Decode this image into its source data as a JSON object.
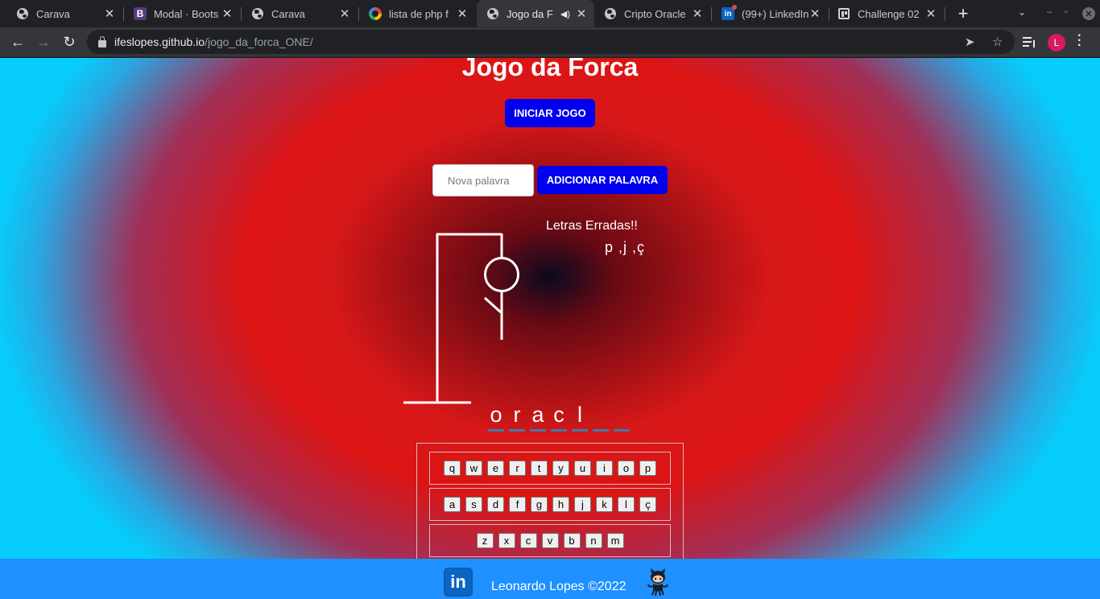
{
  "browser": {
    "tabs": [
      {
        "title": "Carava",
        "favicon": "globe-icon"
      },
      {
        "title": "Modal · Boots",
        "favicon": "bootstrap-icon"
      },
      {
        "title": "Carava",
        "favicon": "globe-icon"
      },
      {
        "title": "lista de php f",
        "favicon": "google-icon"
      },
      {
        "title": "Jogo da F",
        "favicon": "globe-icon",
        "active": true,
        "audio": true
      },
      {
        "title": "Cripto Oracle",
        "favicon": "globe-icon"
      },
      {
        "title": "(99+) LinkedIn",
        "favicon": "linkedin-icon"
      },
      {
        "title": "Challenge 02",
        "favicon": "trello-icon"
      }
    ],
    "url_host": "ifeslopes.github.io",
    "url_path": "/jogo_da_forca_ONE/",
    "profile_initial": "L"
  },
  "game": {
    "title": "Jogo da Forca",
    "start_button": "INICIAR JOGO",
    "new_word_placeholder": "Nova palavra",
    "add_word_button": "ADICIONAR PALAVRA",
    "wrong_letters_title": "Letras Erradas!!",
    "wrong_letters": "p ,j ,ç",
    "word_slots": [
      "o",
      "r",
      "a",
      "c",
      "l",
      "",
      ""
    ],
    "keyboard_rows": [
      [
        "q",
        "w",
        "e",
        "r",
        "t",
        "y",
        "u",
        "i",
        "o",
        "p"
      ],
      [
        "a",
        "s",
        "d",
        "f",
        "g",
        "h",
        "j",
        "k",
        "l",
        "ç"
      ],
      [
        "z",
        "x",
        "c",
        "v",
        "b",
        "n",
        "m"
      ]
    ],
    "accent_color": "#0000ee"
  },
  "footer": {
    "text": "Leonardo Lopes ©2022",
    "linkedin_label": "in"
  }
}
